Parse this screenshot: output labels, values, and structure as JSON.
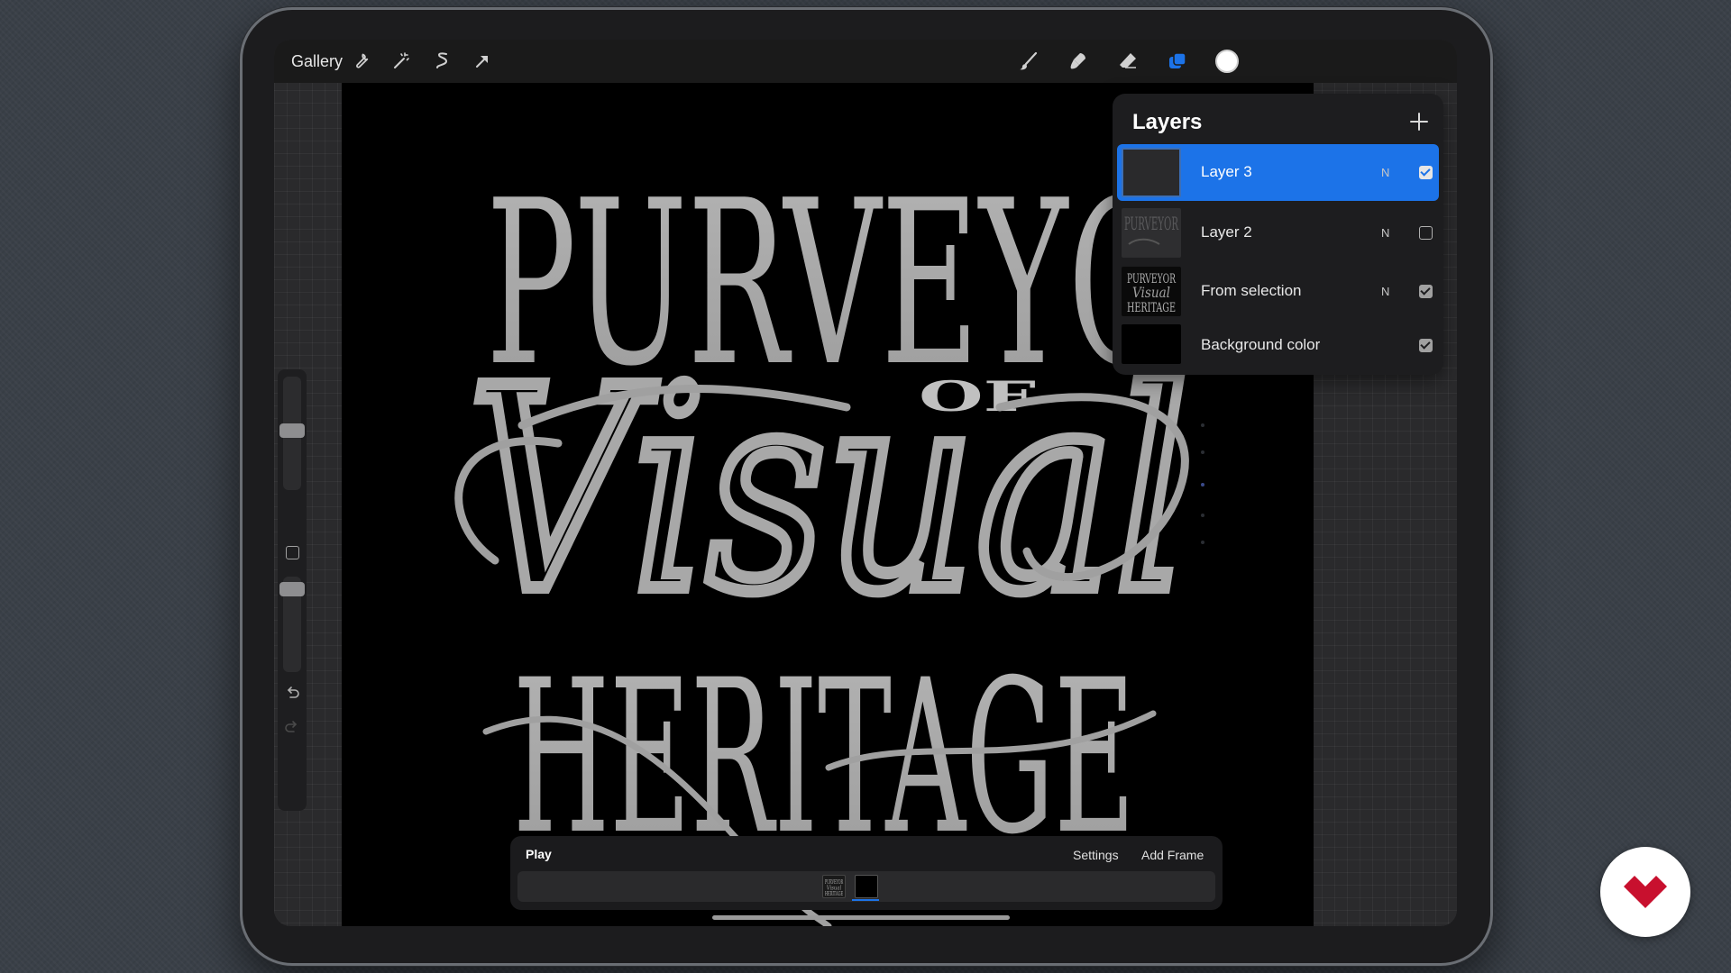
{
  "topbar": {
    "gallery_label": "Gallery",
    "left_tools": [
      "wrench-icon",
      "magic-wand-icon",
      "selection-icon",
      "transform-arrow-icon"
    ],
    "right_tools": [
      "brush-icon",
      "smudge-icon",
      "eraser-icon",
      "layers-icon",
      "color-swatch"
    ],
    "accent_color": "#1c73e8",
    "current_color": "#ffffff"
  },
  "artwork": {
    "line1": "PURVEYOR",
    "line2": "OF",
    "line3": "Visual",
    "line4": "HERITAGE",
    "ink_color": "#a8a8a8",
    "canvas_color": "#000000"
  },
  "sidebar": {
    "brush_size_level": 0.48,
    "opacity_level": 0.95
  },
  "layers_panel": {
    "title": "Layers",
    "add_icon": "plus-icon",
    "layers": [
      {
        "name": "Layer 3",
        "blend": "N",
        "visible": true,
        "selected": true
      },
      {
        "name": "Layer 2",
        "blend": "N",
        "visible": false,
        "selected": false
      },
      {
        "name": "From selection",
        "blend": "N",
        "visible": true,
        "selected": false
      },
      {
        "name": "Background color",
        "blend": "",
        "visible": true,
        "selected": false
      }
    ]
  },
  "animation_bar": {
    "play_label": "Play",
    "settings_label": "Settings",
    "add_frame_label": "Add Frame",
    "frames": 2,
    "selected_frame": 2
  }
}
